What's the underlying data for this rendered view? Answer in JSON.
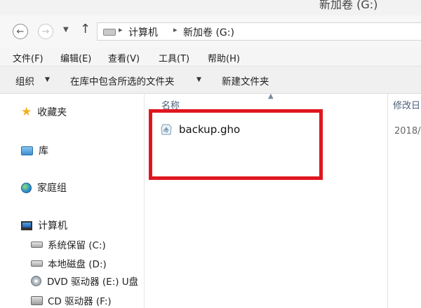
{
  "window": {
    "title": "新加卷 (G:)"
  },
  "address": {
    "crumbs": [
      "计算机",
      "新加卷 (G:)"
    ]
  },
  "menu": [
    "文件(F)",
    "编辑(E)",
    "查看(V)",
    "工具(T)",
    "帮助(H)"
  ],
  "toolbar": {
    "organize": "组织",
    "include_in_library": "在库中包含所选的文件夹",
    "new_folder": "新建文件夹"
  },
  "nav": {
    "favorites": "收藏夹",
    "libraries": "库",
    "homegroup": "家庭组",
    "computer": "计算机",
    "drives": [
      {
        "label": "系统保留 (C:)",
        "icon": "drive-icon"
      },
      {
        "label": "本地磁盘 (D:)",
        "icon": "drive-icon"
      },
      {
        "label": "DVD 驱动器 (E:) U盘",
        "icon": "dvd-icon"
      },
      {
        "label": "CD 驱动器 (F:)",
        "icon": "cd-icon"
      }
    ]
  },
  "columns": {
    "name": "名称",
    "date_modified": "修改日"
  },
  "files": [
    {
      "name": "backup.gho",
      "date": "2018/"
    }
  ],
  "colors": {
    "highlight": "#e0161f",
    "header_text": "#4c607a"
  }
}
